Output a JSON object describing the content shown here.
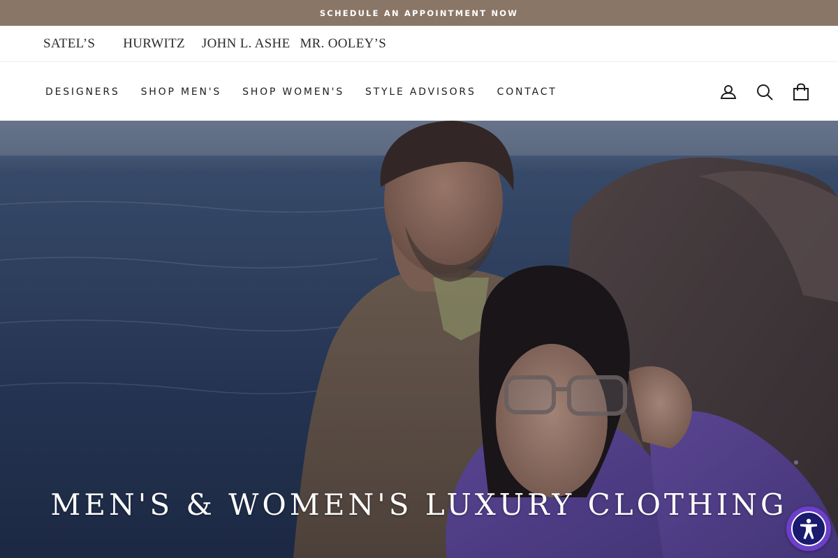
{
  "announcement": {
    "text": "SCHEDULE AN APPOINTMENT NOW"
  },
  "brands": [
    {
      "label": "SATEL’S"
    },
    {
      "label": "HURWITZ"
    },
    {
      "label": "JOHN L. ASHE"
    },
    {
      "label": "MR. OOLEY’S"
    }
  ],
  "nav": {
    "links": [
      {
        "label": "DESIGNERS"
      },
      {
        "label": "SHOP MEN'S"
      },
      {
        "label": "SHOP WOMEN'S"
      },
      {
        "label": "STYLE ADVISORS"
      },
      {
        "label": "CONTACT"
      }
    ],
    "icons": [
      "user-icon",
      "search-icon",
      "cart-icon"
    ]
  },
  "hero": {
    "title": "MEN'S & WOMEN'S LUXURY CLOTHING",
    "image": "couple-by-ocean-photo"
  },
  "accessibility": {
    "icon": "accessibility-icon",
    "color": "#6b3fc9"
  },
  "colors": {
    "announcement_bg": "#8a7667",
    "text": "#1c1d1d"
  }
}
